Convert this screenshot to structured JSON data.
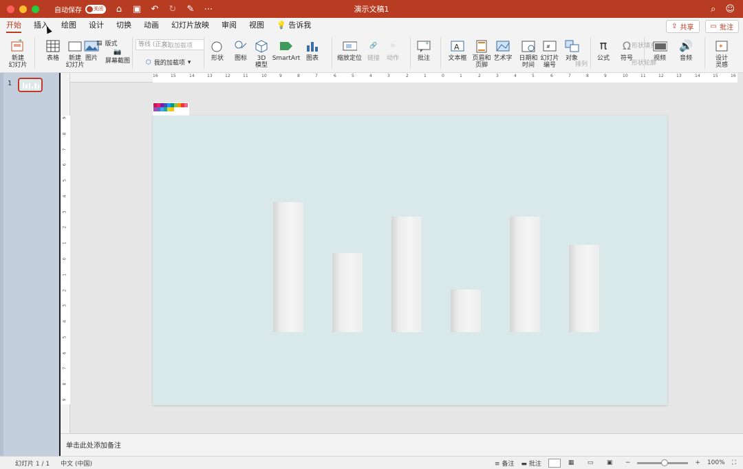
{
  "titlebar": {
    "autosave_label": "自动保存",
    "autosave_state": "关闭",
    "document_title": "演示文稿1"
  },
  "tabs": [
    {
      "label": "开始",
      "active": true
    },
    {
      "label": "插入",
      "active": false
    },
    {
      "label": "绘图",
      "active": false
    },
    {
      "label": "设计",
      "active": false
    },
    {
      "label": "切换",
      "active": false
    },
    {
      "label": "动画",
      "active": false
    },
    {
      "label": "幻灯片放映",
      "active": false
    },
    {
      "label": "审阅",
      "active": false
    },
    {
      "label": "视图",
      "active": false
    },
    {
      "label": "告诉我",
      "active": false
    }
  ],
  "header_buttons": {
    "share": "共享",
    "comment": "批注"
  },
  "ribbon": {
    "new_slide": "新建\n幻灯片",
    "table": "表格",
    "new_slide2": "新建\n幻灯片",
    "picture": "图片",
    "screenshot": "屏幕截图",
    "format": "版式",
    "font_placeholder": "等线 (正文)",
    "addins_get": "获取加载项",
    "my_addins": "我的加载项",
    "shapes": "形状",
    "icons": "图标",
    "model3d": "3D\n模型",
    "smartart": "SmartArt",
    "chart": "图表",
    "zoom": "缩放定位",
    "link": "链接",
    "action": "动作",
    "comment": "批注",
    "textbox": "文本框",
    "header_footer": "页眉和\n页脚",
    "wordart": "艺术字",
    "datetime": "日期和\n时间",
    "slide_number": "幻灯片\n编号",
    "object": "对象",
    "equation": "公式",
    "symbol": "符号",
    "video": "视频",
    "audio": "音频",
    "design_ideas": "设计\n灵感",
    "dim_labels": [
      "排列",
      "形状填充",
      "形状轮廓",
      "SmartArt",
      "编号"
    ]
  },
  "thumbnails": {
    "slide_number": "1"
  },
  "rulers": {
    "h_ticks": [
      "16",
      "15",
      "14",
      "13",
      "12",
      "11",
      "10",
      "9",
      "8",
      "7",
      "6",
      "5",
      "4",
      "3",
      "2",
      "1",
      "0",
      "1",
      "2",
      "3",
      "4",
      "5",
      "6",
      "7",
      "8",
      "9",
      "10",
      "11",
      "12",
      "13",
      "14",
      "15",
      "16"
    ],
    "v_ticks": [
      "9",
      "8",
      "7",
      "6",
      "5",
      "4",
      "3",
      "2",
      "1",
      "0",
      "1",
      "2",
      "3",
      "4",
      "5",
      "6",
      "7",
      "8",
      "9"
    ]
  },
  "slide": {
    "background": "#d9e8e8",
    "bars": [
      0.82,
      0.5,
      0.73,
      0.27,
      0.73,
      0.55
    ]
  },
  "notes": {
    "placeholder": "单击此处添加备注"
  },
  "status": {
    "slide_counter": "幻灯片 1 / 1",
    "language": "中文 (中国)",
    "notes_btn": "备注",
    "comments_btn": "批注",
    "zoom": "100%"
  },
  "colors": {
    "accent": "#b83c22",
    "thumb_border": "#c0392b"
  }
}
